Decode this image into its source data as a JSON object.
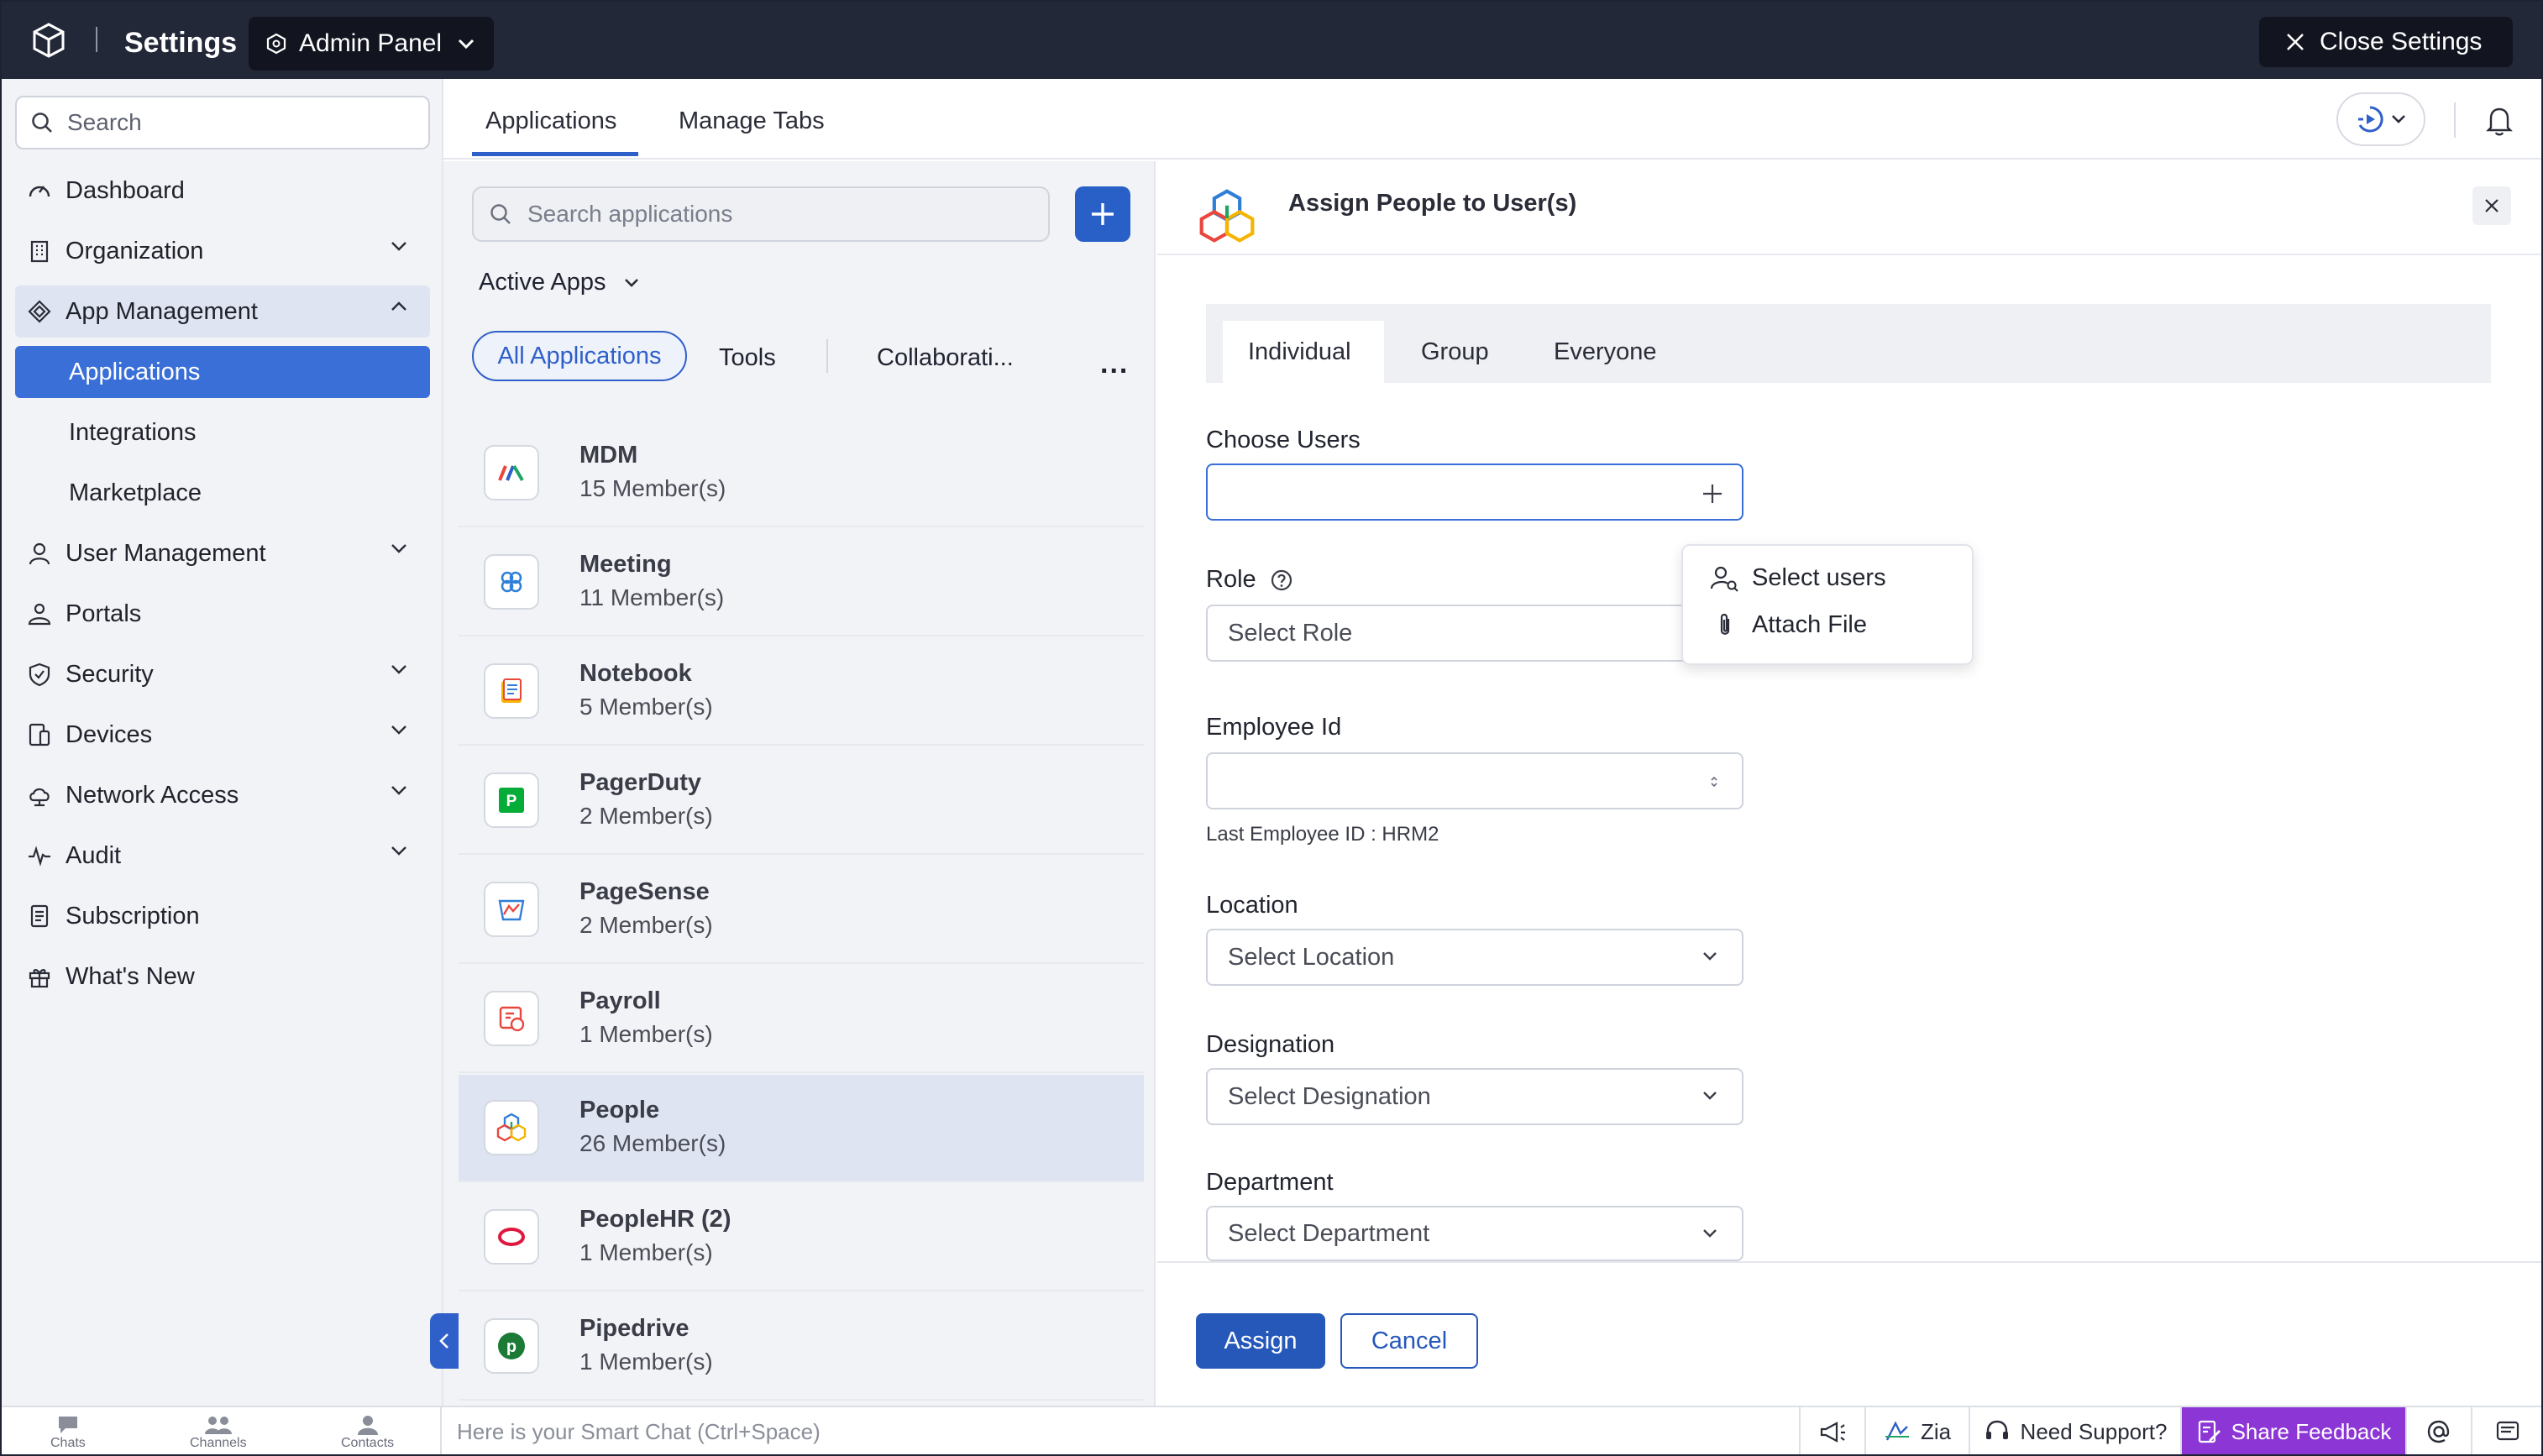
{
  "topbar": {
    "title": "Settings",
    "admin_panel": "Admin Panel",
    "close_settings": "Close Settings"
  },
  "sidebar": {
    "search_placeholder": "Search",
    "items": [
      {
        "label": "Dashboard",
        "icon": "gauge-icon"
      },
      {
        "label": "Organization",
        "icon": "building-icon"
      },
      {
        "label": "App Management",
        "icon": "app-management-icon"
      },
      {
        "label": "Applications"
      },
      {
        "label": "Integrations"
      },
      {
        "label": "Marketplace"
      },
      {
        "label": "User Management",
        "icon": "user-icon"
      },
      {
        "label": "Portals",
        "icon": "portals-icon"
      },
      {
        "label": "Security",
        "icon": "shield-icon"
      },
      {
        "label": "Devices",
        "icon": "devices-icon"
      },
      {
        "label": "Network Access",
        "icon": "cloud-icon"
      },
      {
        "label": "Audit",
        "icon": "pulse-icon"
      },
      {
        "label": "Subscription",
        "icon": "document-icon"
      },
      {
        "label": "What's New",
        "icon": "gift-icon"
      }
    ]
  },
  "main_tabs": {
    "applications": "Applications",
    "manage_tabs": "Manage Tabs"
  },
  "app_list": {
    "search_placeholder": "Search applications",
    "filter_label": "Active Apps",
    "categories": [
      "All Applications",
      "Tools",
      "Collaborati...",
      "..."
    ],
    "apps": [
      {
        "name": "MDM",
        "members": "15 Member(s)"
      },
      {
        "name": "Meeting",
        "members": "11 Member(s)"
      },
      {
        "name": "Notebook",
        "members": "5 Member(s)"
      },
      {
        "name": "PagerDuty",
        "members": "2 Member(s)"
      },
      {
        "name": "PageSense",
        "members": "2 Member(s)"
      },
      {
        "name": "Payroll",
        "members": "1 Member(s)"
      },
      {
        "name": "People",
        "members": "26 Member(s)"
      },
      {
        "name": "PeopleHR (2)",
        "members": "1 Member(s)"
      },
      {
        "name": "Pipedrive",
        "members": "1 Member(s)"
      }
    ],
    "selected_app": "People"
  },
  "assign_panel": {
    "title": "Assign People to User(s)",
    "segments": [
      "Individual",
      "Group",
      "Everyone"
    ],
    "selected_segment": "Individual",
    "choose_users_label": "Choose Users",
    "choose_users_value": "",
    "role_label": "Role",
    "role_placeholder": "Select Role",
    "employee_id_label": "Employee Id",
    "employee_id_value": "",
    "employee_id_hint": "Last Employee ID : HRM2",
    "location_label": "Location",
    "location_placeholder": "Select Location",
    "designation_label": "Designation",
    "designation_placeholder": "Select Designation",
    "department_label": "Department",
    "department_placeholder": "Select Department",
    "dropdown_menu": [
      "Select users",
      "Attach File"
    ],
    "assign_button": "Assign",
    "cancel_button": "Cancel"
  },
  "bottombar": {
    "chats": "Chats",
    "channels": "Channels",
    "contacts": "Contacts",
    "chat_placeholder": "Here is your Smart Chat (Ctrl+Space)",
    "zia": "Zia",
    "need_support": "Need Support?",
    "share_feedback": "Share Feedback"
  },
  "colors": {
    "topbar_bg": "#232839",
    "accent_blue": "#2f5fc9",
    "active_sidebar": "#3a6fd8",
    "feedback_purple": "#8d36d6"
  }
}
